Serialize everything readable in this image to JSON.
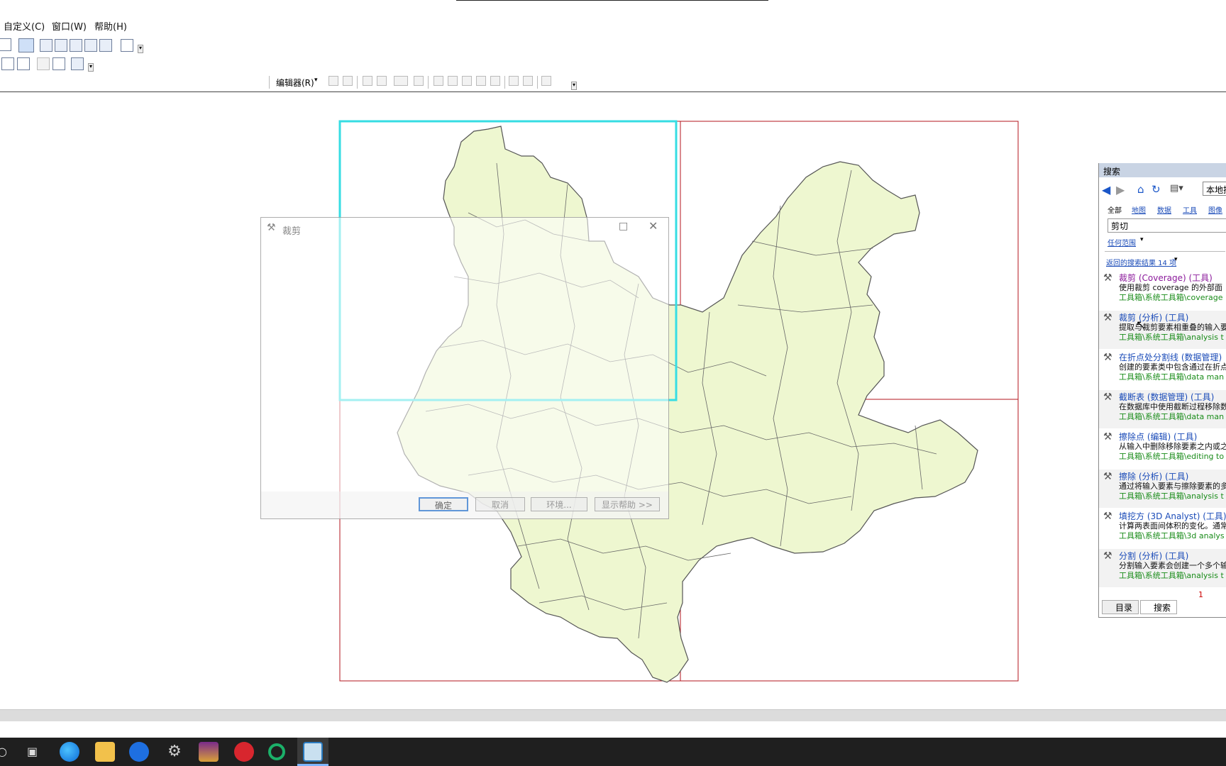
{
  "menu": [
    {
      "label": "自定义(C)"
    },
    {
      "label": "窗口(W)"
    },
    {
      "label": "帮助(H)"
    }
  ],
  "toolbar": {
    "editor_label": "编辑器(R)"
  },
  "dialog": {
    "title": "裁剪",
    "ok_label": "确定",
    "cancel_label": "取消",
    "env_label": "环境...",
    "help_label": "显示帮助 >>"
  },
  "search": {
    "title": "搜索",
    "scope_button": "本地搜",
    "tabs": [
      "全部",
      "地图",
      "数据",
      "工具",
      "图像"
    ],
    "query": "剪切",
    "extent_link": "任何范围",
    "results_summary": "返回的搜索结果 14 项",
    "results": [
      {
        "title": "裁剪 (Coverage) (工具)",
        "desc": "使用裁剪 coverage 的外部面",
        "path": "工具箱\\系统工具箱\\coverage"
      },
      {
        "title": "裁剪 (分析) (工具)",
        "desc": "提取与裁剪要素相重叠的输入要",
        "path": "工具箱\\系统工具箱\\analysis t"
      },
      {
        "title": "在折点处分割线 (数据管理)",
        "desc": "创建的要素类中包含通过在折点",
        "path": "工具箱\\系统工具箱\\data man"
      },
      {
        "title": "截断表 (数据管理) (工具)",
        "desc": "在数据库中使用截断过程移除数",
        "path": "工具箱\\系统工具箱\\data man"
      },
      {
        "title": "擦除点 (编辑) (工具)",
        "desc": "从输入中删除移除要素之内或之",
        "path": "工具箱\\系统工具箱\\editing to"
      },
      {
        "title": "擦除 (分析) (工具)",
        "desc": "通过将输入要素与擦除要素的多",
        "path": "工具箱\\系统工具箱\\analysis t"
      },
      {
        "title": "填挖方 (3D Analyst) (工具)",
        "desc": "计算两表面间体积的变化。通常",
        "path": "工具箱\\系统工具箱\\3d analys"
      },
      {
        "title": "分割 (分析) (工具)",
        "desc": "分割输入要素会创建一个多个输",
        "path": "工具箱\\系统工具箱\\analysis t"
      }
    ],
    "page": "1",
    "bottom_tabs": [
      "目录",
      "搜索"
    ]
  },
  "colors": {
    "map_fill": "#eef7d0",
    "frame_red": "#b3141c",
    "selection_cyan": "#36dde3"
  },
  "taskbar_icons": [
    "search-icon",
    "task-view-icon",
    "edge-icon",
    "file-explorer-icon",
    "bing-icon",
    "app-icon",
    "winrar-icon",
    "netease-music-icon",
    "green-circle-icon",
    "arcmap-icon"
  ]
}
